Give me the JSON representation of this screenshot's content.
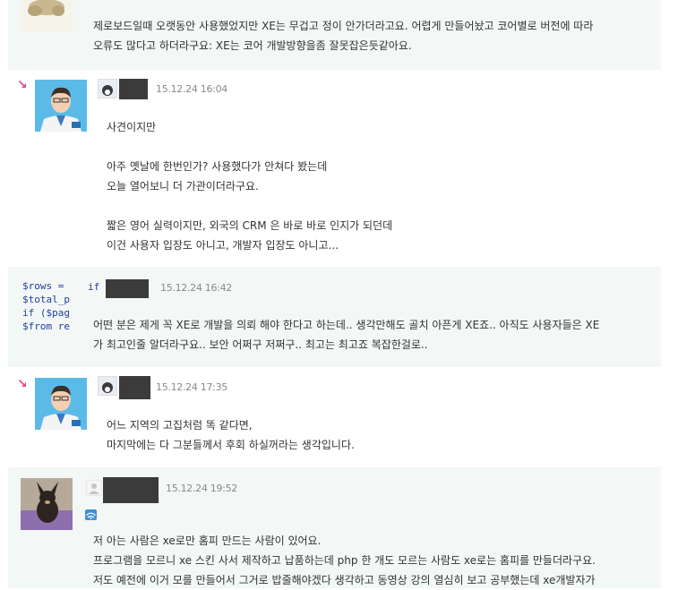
{
  "comments": [
    {
      "lines": [
        "제로보드일때 오랫동안 사용했었지만 XE는 무겁고 정이 안가더라고요. 어렵게 만들어놨고 코어별로 버전에 따라",
        "오류도 많다고 하더라구요:  XE는 코어 개발방향을좀 잘못잡은듯같아요."
      ]
    },
    {
      "date": "15.12.24 16:04",
      "lines": [
        "사견이지만",
        "",
        "아주 옛날에 한번인가? 사용했다가 안쳐다 봤는데",
        "오늘 열어보니 더 가관이더라구요.",
        "",
        "짧은 영어 실력이지만, 외국의 CRM 은 바로 바로 인지가 되던데",
        "이건 사용자 입장도 아니고, 개발자 입장도 아니고..."
      ]
    },
    {
      "code": [
        "$rows =",
        "$total_p",
        "if ($pag",
        "$from re"
      ],
      "code_prefix": "if",
      "date": "15.12.24 16:42",
      "lines": [
        "어떤 분은 제게 꼭 XE로 개발을 의뢰 해야 한다고 하는데.. 생각만해도 골치 아픈게 XE죠.. 아직도 사용자들은 XE",
        "가 최고인줄 알더라구요.. 보안 어쩌구 저쩌구.. 최고는 최고죠 복잡한걸로.."
      ]
    },
    {
      "date": "15.12.24 17:35",
      "lines": [
        "어느 지역의 고집처럼 똑 같다면,",
        "마지막에는 다 그분들께서 후회 하실꺼라는 생각입니다."
      ]
    },
    {
      "date": "15.12.24 19:52",
      "lines": [
        "저 아는 사람은 xe로만 홈피 만드는 사람이 있어요.",
        "프로그램을 모르니 xe 스킨 사서 제작하고 납품하는데 php 한 개도 모르는 사람도 xe로는 홈피를 만들더라구요.",
        "저도 예전에 이거 모를 만들어서 그거로 밥줄해야겠다 생각하고 동영상 강의 열심히 보고 공부했는데 xe개발자가"
      ]
    }
  ],
  "colors": {
    "alt_bg": "#f3f7f6",
    "reply_arrow": "#e0448a",
    "code": "#1e3d9e"
  },
  "icons": {
    "reply": "reply-arrow-icon",
    "person": "person-icon",
    "wifi": "wifi-icon"
  }
}
